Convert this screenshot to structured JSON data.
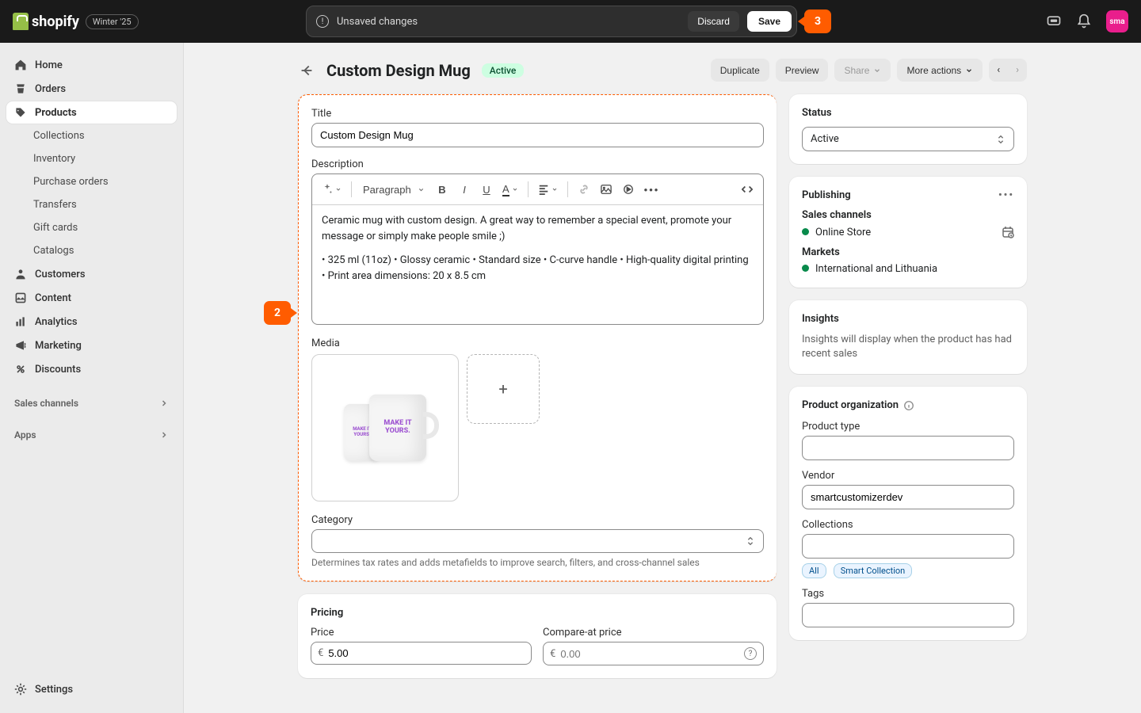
{
  "brand": {
    "name": "shopify",
    "edition": "Winter '25"
  },
  "save_bar": {
    "message": "Unsaved changes",
    "discard": "Discard",
    "save": "Save"
  },
  "callouts": {
    "step2": "2",
    "step3": "3"
  },
  "avatar_initials": "sma",
  "nav": {
    "home": "Home",
    "orders": "Orders",
    "products": "Products",
    "collections": "Collections",
    "inventory": "Inventory",
    "purchase_orders": "Purchase orders",
    "transfers": "Transfers",
    "gift_cards": "Gift cards",
    "catalogs": "Catalogs",
    "customers": "Customers",
    "content": "Content",
    "analytics": "Analytics",
    "marketing": "Marketing",
    "discounts": "Discounts",
    "sales_channels": "Sales channels",
    "apps": "Apps",
    "settings": "Settings"
  },
  "page": {
    "title": "Custom Design Mug",
    "status_badge": "Active",
    "actions": {
      "duplicate": "Duplicate",
      "preview": "Preview",
      "share": "Share",
      "more": "More actions"
    }
  },
  "form": {
    "title_label": "Title",
    "title_value": "Custom Design Mug",
    "desc_label": "Description",
    "desc_p1": "Ceramic mug with custom design. A great way to remember a special event, promote your message or simply make people smile ;)",
    "desc_p2": "• 325 ml (11oz) • Glossy ceramic • Standard size • C-curve handle • High-quality digital printing • Print area dimensions: 20 x 8.5 cm",
    "paragraph_sel": "Paragraph",
    "media_label": "Media",
    "mug_text": "MAKE IT YOURS.",
    "category_label": "Category",
    "category_hint": "Determines tax rates and adds metafields to improve search, filters, and cross-channel sales",
    "pricing": {
      "heading": "Pricing",
      "price_label": "Price",
      "compare_label": "Compare-at price",
      "currency": "€",
      "price_value": "5.00",
      "compare_placeholder": "0.00"
    }
  },
  "side": {
    "status_h": "Status",
    "status_value": "Active",
    "publishing_h": "Publishing",
    "sales_channels_h": "Sales channels",
    "channel_online": "Online Store",
    "markets_h": "Markets",
    "markets_value": "International and Lithuania",
    "insights_h": "Insights",
    "insights_text": "Insights will display when the product has had recent sales",
    "org_h": "Product organization",
    "product_type_label": "Product type",
    "vendor_label": "Vendor",
    "vendor_value": "smartcustomizerdev",
    "collections_label": "Collections",
    "coll_tag1": "All",
    "coll_tag2": "Smart Collection",
    "tags_label": "Tags"
  }
}
